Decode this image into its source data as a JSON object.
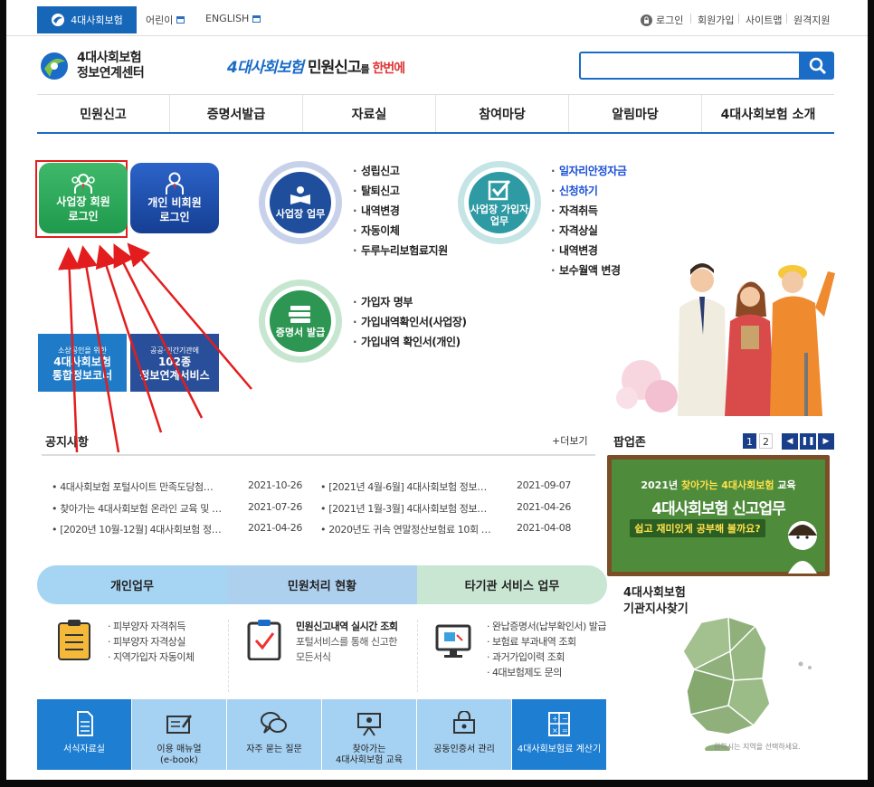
{
  "topbar": {
    "home": "4대사회보험",
    "kids": "어린이",
    "english": "ENGLISH",
    "login": "로그인",
    "join": "회원가입",
    "sitemap": "사이트맵",
    "remote": "원격지원"
  },
  "header": {
    "logo_line1": "4대사회보험",
    "logo_line2": "정보연계센터",
    "slogan_blue": "4대사회보험",
    "slogan_black": " 민원신고",
    "slogan_small": "를",
    "slogan_red": " 한번에"
  },
  "nav": [
    "민원신고",
    "증명서발급",
    "자료실",
    "참여마당",
    "알림마당",
    "4대사회보험 소개"
  ],
  "login_buttons": {
    "biz": {
      "line1": "사업장 회원",
      "line2": "로그인"
    },
    "ind": {
      "line1": "개인 비회원",
      "line2": "로그인"
    }
  },
  "circles": {
    "biz": {
      "label": "사업장 업무",
      "items": [
        "성립신고",
        "탈퇴신고",
        "내역변경",
        "자동이체",
        "두루누리보험료지원"
      ]
    },
    "subscriber": {
      "label_line1": "사업장 가입자",
      "label_line2": "업무",
      "items": [
        "일자리안정자금",
        "신청하기",
        "자격취득",
        "자격상실",
        "내역변경",
        "보수월액 변경"
      ]
    },
    "cert": {
      "label": "증명서 발급",
      "items": [
        "가입자 명부",
        "가입내역확인서(사업장)",
        "가입내역 확인서(개인)"
      ]
    }
  },
  "banners": {
    "ban1": {
      "small": "소상공인을 위한",
      "line1": "4대사회보험",
      "line2": "통합정보코너"
    },
    "ban2": {
      "small": "공공·민간기관에",
      "line1": "102종",
      "line2": "정보연계서비스"
    }
  },
  "notice": {
    "title": "공지사항",
    "more": "+더보기",
    "left": [
      {
        "title": "4대사회보험 포털사이트 만족도당첨…",
        "date": "2021-10-26"
      },
      {
        "title": "찾아가는 4대사회보험 온라인 교육 및 …",
        "date": "2021-07-26"
      },
      {
        "title": "[2020년 10월-12월] 4대사회보험 정…",
        "date": "2021-04-26"
      }
    ],
    "right": [
      {
        "title": "[2021년 4월-6월] 4대사회보험 정보…",
        "date": "2021-09-07"
      },
      {
        "title": "[2021년 1월-3월] 4대사회보험 정보…",
        "date": "2021-04-26"
      },
      {
        "title": "2020년도 귀속 연말정산보험료 10회 …",
        "date": "2021-04-08"
      }
    ]
  },
  "popup": {
    "title": "팝업존",
    "pages": [
      "1",
      "2"
    ],
    "line1_prefix": "2021년",
    "line1_highlight": "찾아가는 4대사회보험",
    "line1_suffix": "교육",
    "line2": "4대사회보험 신고업무",
    "line3": "쉽고 재미있게 공부해 볼까요?"
  },
  "tabs": [
    "개인업무",
    "민원처리 현황",
    "타기관 서비스 업무"
  ],
  "tab_content": {
    "personal": [
      "피부양자 자격취득",
      "피부양자 자격상실",
      "지역가입자 자동이체"
    ],
    "status_title": "민원신고내역 실시간 조회",
    "status_desc1": "포털서비스를 통해 신고한",
    "status_desc2": "모든서식",
    "other": [
      "완납증명서(납부확인서) 발급",
      "보험료 부과내역 조회",
      "과거가입이력 조회",
      "4대보험제도 문의"
    ]
  },
  "bottom": [
    {
      "label": "서식자료실",
      "icon": "document-icon"
    },
    {
      "label": "이용 매뉴얼",
      "label2": "(e-book)",
      "icon": "book-edit-icon"
    },
    {
      "label": "자주 묻는 질문",
      "icon": "chat-bubbles-icon"
    },
    {
      "label": "찾아가는",
      "label2": "4대사회보험 교육",
      "icon": "presentation-icon"
    },
    {
      "label": "공동인증서 관리",
      "icon": "certificate-icon"
    },
    {
      "label": "4대사회보험료 계산기",
      "icon": "calculator-icon"
    }
  ],
  "map": {
    "title_line1": "4대사회보험",
    "title_line2": "기관지사찾기",
    "note": "원하시는 지역을 선택하세요."
  },
  "colors": {
    "primary": "#1a6cc6",
    "green": "#1f9a4d",
    "annotation_red": "#e31d1d"
  }
}
